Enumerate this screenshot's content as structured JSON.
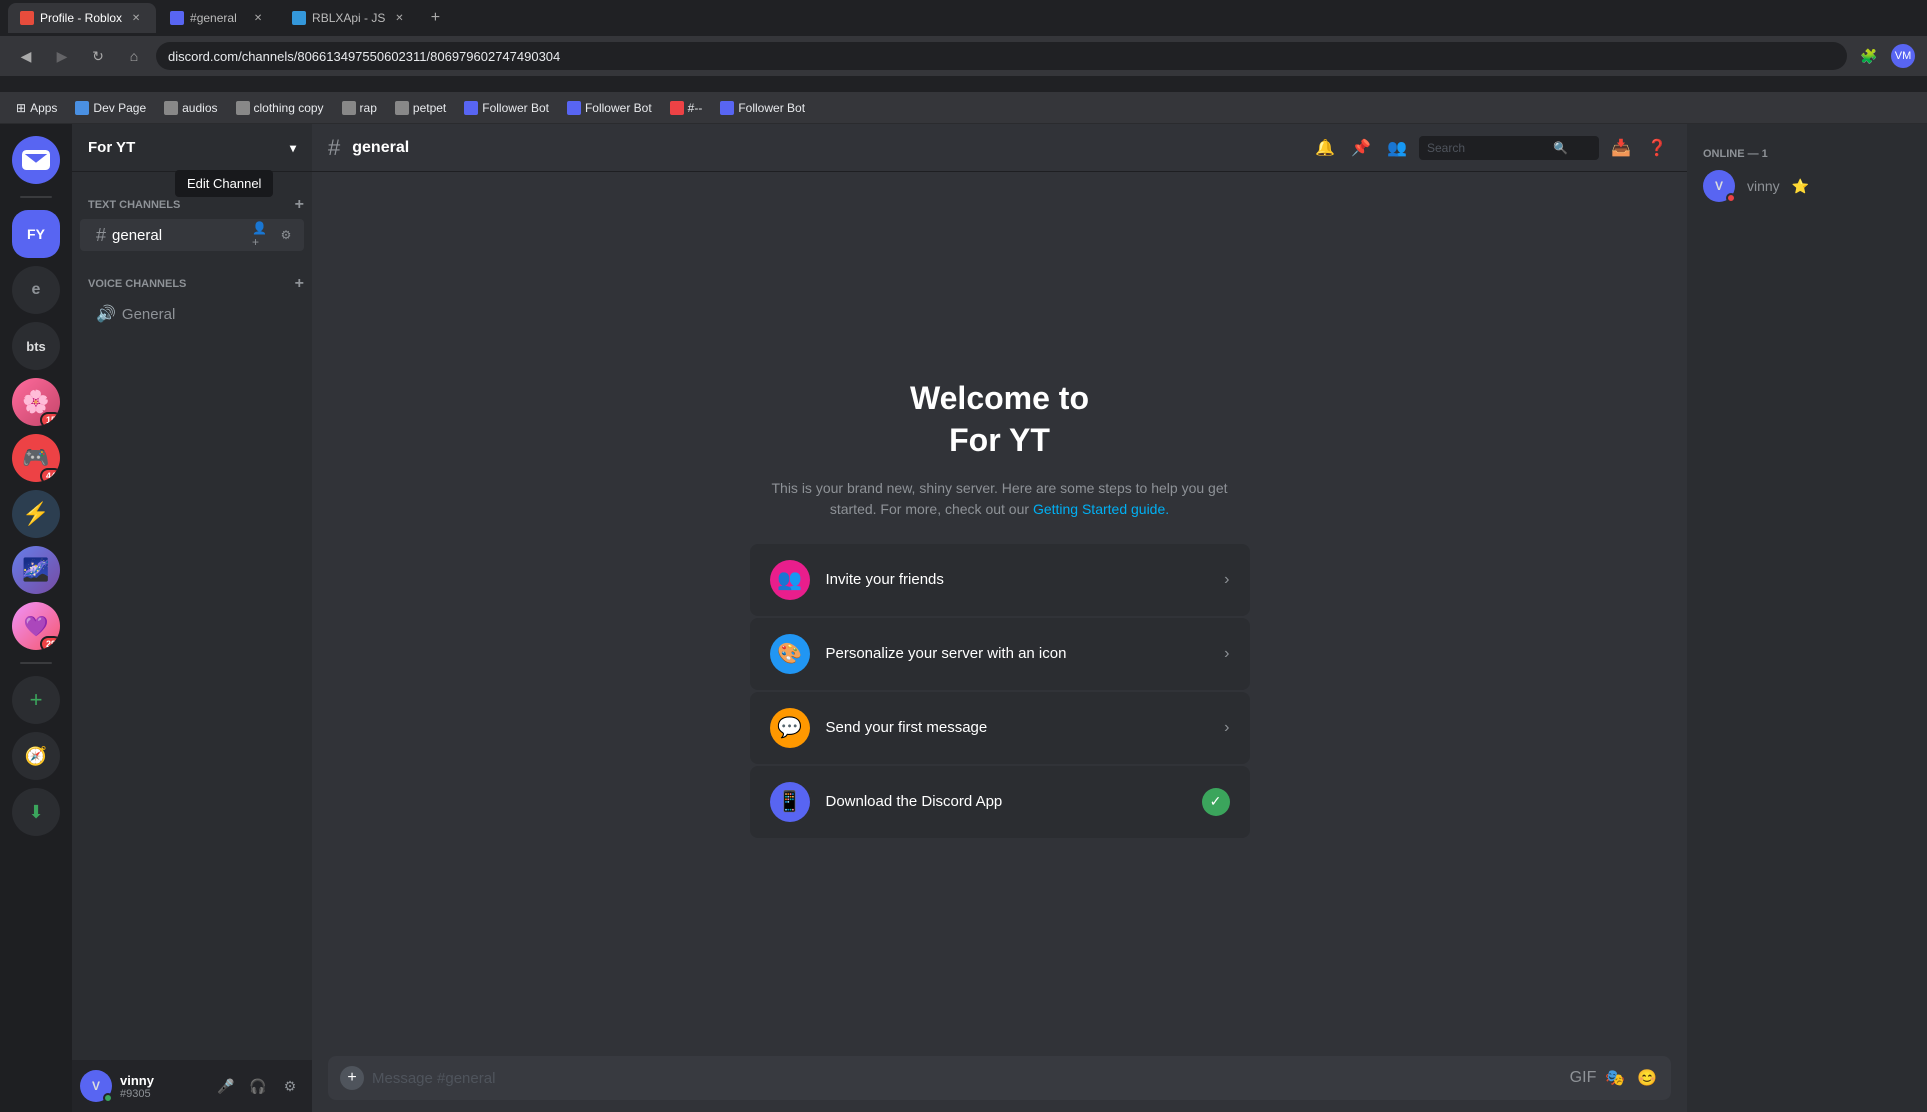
{
  "browser": {
    "tabs": [
      {
        "id": "tab1",
        "favicon_color": "#e74c3c",
        "label": "Profile - Roblox",
        "active": true
      },
      {
        "id": "tab2",
        "favicon_color": "#5865f2",
        "label": "#general",
        "active": false
      },
      {
        "id": "tab3",
        "favicon_color": "#3498db",
        "label": "RBLXApi - JS",
        "active": false
      }
    ],
    "url": "discord.com/channels/806613497550602311/806979602747490304",
    "bookmarks": [
      {
        "label": "Apps",
        "favicon_color": "#888"
      },
      {
        "label": "Dev Page",
        "favicon_color": "#4a90e2"
      },
      {
        "label": "audios",
        "favicon_color": "#888"
      },
      {
        "label": "clothing copy",
        "favicon_color": "#888"
      },
      {
        "label": "rap",
        "favicon_color": "#888"
      },
      {
        "label": "petpet",
        "favicon_color": "#888"
      },
      {
        "label": "Follower Bot",
        "favicon_color": "#5865f2"
      },
      {
        "label": "Follower Bot",
        "favicon_color": "#5865f2"
      },
      {
        "label": "#--",
        "favicon_color": "#ed4245"
      },
      {
        "label": "Follower Bot",
        "favicon_color": "#5865f2"
      }
    ]
  },
  "discord": {
    "server_name": "For YT",
    "channel_name": "general",
    "channel_placeholder": "Message #general",
    "welcome_title_line1": "Welcome to",
    "welcome_title_line2": "For YT",
    "welcome_desc": "This is your brand new, shiny server. Here are some steps to help you get started. For more, check out our",
    "welcome_desc_link": "Getting Started guide.",
    "action_cards": [
      {
        "id": "invite",
        "label": "Invite your friends",
        "icon": "👥",
        "icon_bg": "#e91e8c",
        "has_check": false
      },
      {
        "id": "personalize",
        "label": "Personalize your server with an icon",
        "icon": "🎨",
        "icon_bg": "#2196f3",
        "has_check": false
      },
      {
        "id": "message",
        "label": "Send your first message",
        "icon": "💬",
        "icon_bg": "#ff9800",
        "has_check": false
      },
      {
        "id": "download",
        "label": "Download the Discord App",
        "icon": "📱",
        "icon_bg": "#5865f2",
        "has_check": true
      }
    ],
    "text_channels_label": "TEXT CHANNELS",
    "voice_channels_label": "VOICE CHANNELS",
    "channels": [
      {
        "name": "general",
        "type": "text",
        "active": true
      }
    ],
    "voice_channels": [
      {
        "name": "General",
        "type": "voice"
      }
    ],
    "members": {
      "online_label": "ONLINE — 1",
      "list": [
        {
          "name": "vinny",
          "tag": "",
          "status": "dnd",
          "initial": "V",
          "badge": "⭐"
        }
      ]
    },
    "user": {
      "name": "vinny",
      "tag": "#9305",
      "initial": "V",
      "status": "online"
    },
    "edit_channel_tooltip": "Edit Channel",
    "search_placeholder": "Search"
  }
}
